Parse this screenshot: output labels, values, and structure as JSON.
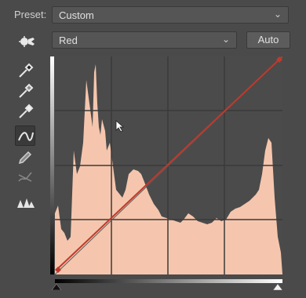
{
  "preset": {
    "label": "Preset:",
    "value": "Custom"
  },
  "channel": {
    "value": "Red"
  },
  "auto_button": {
    "label": "Auto"
  },
  "tools": [
    {
      "icon": "eyedropper-black-icon"
    },
    {
      "icon": "eyedropper-gray-icon"
    },
    {
      "icon": "eyedropper-white-icon"
    },
    {
      "icon": "curve-point-icon",
      "selected": true
    },
    {
      "icon": "pencil-icon"
    },
    {
      "icon": "smooth-icon"
    },
    {
      "icon": "clipping-warning-icon"
    }
  ],
  "colors": {
    "histogram_fill": "#f5c6ad",
    "background": "#4a4a4a",
    "panel": "#555555",
    "curve": "#c0392b",
    "grid": "#3a3a3a"
  }
}
